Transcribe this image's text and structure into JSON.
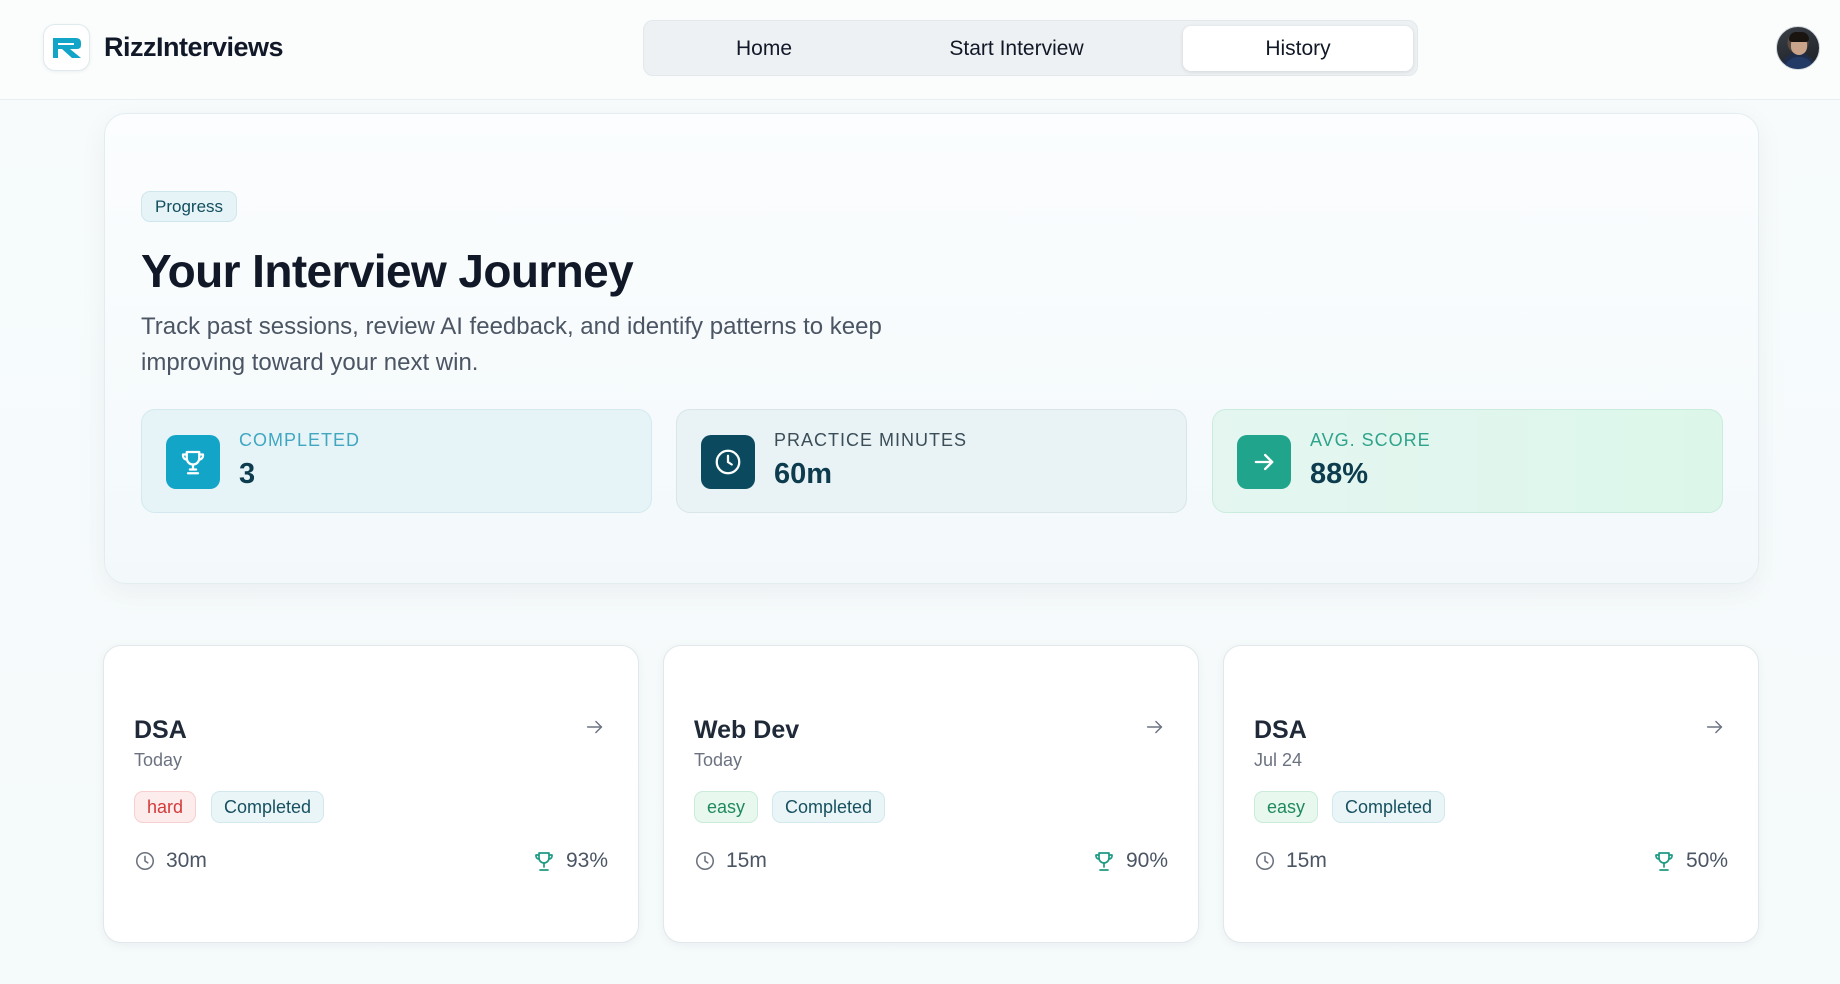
{
  "app": {
    "name": "RizzInterviews"
  },
  "nav": {
    "tabs": [
      {
        "label": "Home",
        "active": false
      },
      {
        "label": "Start Interview",
        "active": false
      },
      {
        "label": "History",
        "active": true
      }
    ]
  },
  "hero": {
    "chip": "Progress",
    "title": "Your Interview Journey",
    "subtitle": "Track past sessions, review AI feedback, and identify patterns to keep improving toward your next win.",
    "stats": [
      {
        "label": "COMPLETED",
        "value": "3",
        "icon": "trophy-icon"
      },
      {
        "label": "PRACTICE MINUTES",
        "value": "60m",
        "icon": "clock-icon"
      },
      {
        "label": "AVG. SCORE",
        "value": "88%",
        "icon": "arrow-right-icon"
      }
    ]
  },
  "sessions": [
    {
      "title": "DSA",
      "date": "Today",
      "difficulty": "hard",
      "status": "Completed",
      "duration": "30m",
      "score": "93%"
    },
    {
      "title": "Web Dev",
      "date": "Today",
      "difficulty": "easy",
      "status": "Completed",
      "duration": "15m",
      "score": "90%"
    },
    {
      "title": "DSA",
      "date": "Jul 24",
      "difficulty": "easy",
      "status": "Completed",
      "duration": "15m",
      "score": "50%"
    }
  ],
  "colors": {
    "accent": "#12a5c7",
    "dark_teal": "#0b4a5e",
    "green": "#21a48c",
    "hard": "#d33a3a",
    "easy": "#1f8a5c"
  }
}
